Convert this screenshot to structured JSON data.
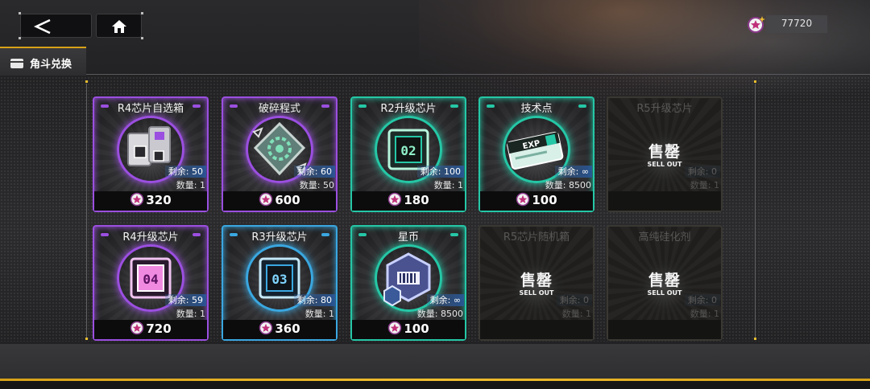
{
  "topbar": {
    "back_icon": "chevron-left-icon",
    "home_icon": "home-icon",
    "currency": {
      "icon": "star-coin-icon",
      "amount": "77720"
    }
  },
  "tab": {
    "label": "角斗兑换",
    "icon": "card-icon"
  },
  "colors": {
    "purple": "#9b4fe0",
    "teal": "#25c7a6",
    "blue": "#3aa7e0",
    "accent_gold": "#d8a218"
  },
  "shop": {
    "items": [
      {
        "name": "R4芯片自选箱",
        "remain": "剩余: 50",
        "qty": "数量: 1",
        "price": "320",
        "rarity": "purple",
        "art": "chip-box",
        "sold_out": false
      },
      {
        "name": "破碎程式",
        "remain": "剩余: 60",
        "qty": "数量: 50",
        "price": "600",
        "rarity": "purple",
        "art": "broken-program",
        "sold_out": false
      },
      {
        "name": "R2升级芯片",
        "remain": "剩余: 100",
        "qty": "数量: 1",
        "price": "180",
        "rarity": "teal",
        "art": "chip-02",
        "sold_out": false
      },
      {
        "name": "技术点",
        "remain": "剩余: ∞",
        "qty": "数量: 8500",
        "price": "100",
        "rarity": "teal",
        "art": "exp-card",
        "sold_out": false
      },
      {
        "name": "R5升级芯片",
        "remain": "剩余: 0",
        "qty": "数量: 1",
        "price": "",
        "rarity": "gold",
        "art": "",
        "sold_out": true
      },
      {
        "name": "R4升级芯片",
        "remain": "剩余: 59",
        "qty": "数量: 1",
        "price": "720",
        "rarity": "purple",
        "art": "chip-04",
        "sold_out": false
      },
      {
        "name": "R3升级芯片",
        "remain": "剩余: 80",
        "qty": "数量: 1",
        "price": "360",
        "rarity": "blue",
        "art": "chip-03",
        "sold_out": false
      },
      {
        "name": "星币",
        "remain": "剩余: ∞",
        "qty": "数量: 8500",
        "price": "100",
        "rarity": "teal",
        "art": "star-coin-hex",
        "sold_out": false
      },
      {
        "name": "R5芯片随机箱",
        "remain": "剩余: 0",
        "qty": "数量: 1",
        "price": "",
        "rarity": "gold",
        "art": "",
        "sold_out": true
      },
      {
        "name": "高纯硅化剂",
        "remain": "剩余: 0",
        "qty": "数量: 1",
        "price": "",
        "rarity": "purple",
        "art": "",
        "sold_out": true
      }
    ],
    "sold_out_cn": "售罄",
    "sold_out_en": "SELL OUT"
  }
}
